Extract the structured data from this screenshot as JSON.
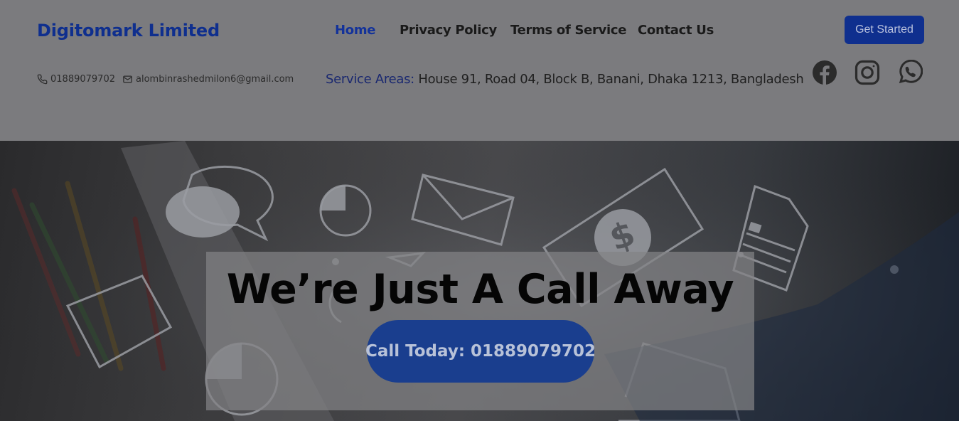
{
  "brand": {
    "name": "Digitomark Limited"
  },
  "nav": {
    "items": [
      {
        "label": "Home"
      },
      {
        "label": "Privacy Policy"
      },
      {
        "label": "Terms of Service"
      },
      {
        "label": "Contact Us"
      }
    ],
    "active": "Home",
    "cta_label": "Get Started"
  },
  "contact": {
    "phone": "01889079702",
    "email": "alombinrashedmilon6@gmail.com",
    "phone_icon": "phone-icon",
    "email_icon": "envelope-icon"
  },
  "service_area": {
    "label": "Service Areas:",
    "address": "House 91, Road 04, Block B, Banani, Dhaka 1213, Bangladesh"
  },
  "social": [
    {
      "icon": "facebook-icon"
    },
    {
      "icon": "instagram-icon"
    },
    {
      "icon": "whatsapp-icon"
    }
  ],
  "hero": {
    "headline": "We’re Just A Call Away",
    "call_button": "Call Today: 01889079702"
  },
  "colors": {
    "brand": "#0f2f8e",
    "active_nav": "#13329a",
    "call_button": "#1a3e8e",
    "overlay": "#7b7b7e"
  }
}
